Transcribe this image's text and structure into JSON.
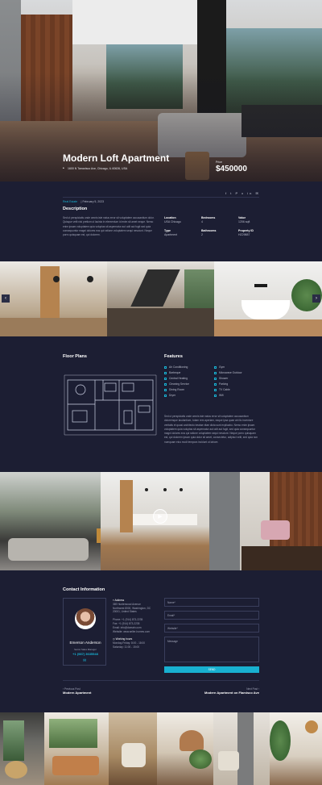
{
  "hero": {
    "title": "Modern Loft Apartment",
    "address": "1600 N Tamarisco Ave, Chicago, IL 60626, USA",
    "price_label": "Price",
    "price": "$450000"
  },
  "meta": {
    "category": "Real Estate",
    "date": "February 5, 2023",
    "share_icons": "f  t  P  x  in  ✉"
  },
  "description": {
    "heading": "Description",
    "paragraphs": [
      "Sed ut perspiciatis unde omnis iste natus error sit voluptatem accusantium dolor. Quisque velit nisi pretium ut lacinia in elementum id enim sit amet neque. Nemo enim ipsam voluptatem quia voluptas sit aspernatur aut odit aut fugit sed quia consequuntur magni dolores eos qui ratione voluptatem sequi nesciunt. Neque porro quisquam est, qui dolorem."
    ]
  },
  "details": [
    {
      "k": "Location",
      "v": "USA Chicago"
    },
    {
      "k": "Bedrooms",
      "v": "4"
    },
    {
      "k": "Value",
      "v": "1206 sqft"
    },
    {
      "k": "Type",
      "v": "Apartment"
    },
    {
      "k": "Bathrooms",
      "v": "2"
    },
    {
      "k": "Property ID",
      "v": "HZ29887"
    }
  ],
  "floor_plans": {
    "heading": "Floor Plans"
  },
  "features": {
    "heading": "Features",
    "items": [
      "Air Conditioning",
      "Gym",
      "Barbeque",
      "Microwave Outdoor",
      "Central Heating",
      "Shower",
      "Cleaning Service",
      "Parking",
      "Dining Room",
      "TV Cable",
      "Dryer",
      "Wifi"
    ],
    "paragraph": "Sed ut perspiciatis unde omnis iste natus error sit voluptatem accusantium doloremque laudantium, totam rem aperiam, eaque ipsa quae ab illo inventore veritatis et quasi architecto beatae vitae dicta sunt explicabo. Nemo enim ipsam voluptatem quia voluptas sit aspernatur aut odit aut fugit, sed quia consequuntur magni dolores eos qui ratione voluptatem sequi nesciunt. Neque porro quisquam est, qui dolorem ipsum quia dolor sit amet, consectetur, adipisci velit, sed quia non numquam eius modi tempora incidunt ut labore."
  },
  "contact": {
    "heading": "Contact Information",
    "agent_name": "Emerson Anderson",
    "agent_role": "Senior Sales Manager",
    "agent_phone": "+1 (987) 3635548",
    "address_label": "Address",
    "address_lines": [
      "369 Hunterwood Avenue",
      "Northwest 8000, Washington, DC",
      "20001, United States"
    ],
    "contact_lines": [
      "Phone: +1 (914) 873-2235",
      "Fax: +1 (914) 873-2235",
      "Email: info@domain.com",
      "Website: www.seller-homes.com"
    ],
    "hours_label": "Working hours",
    "hours_lines": [
      "Monday-Friday: 8:00 - 18:00",
      "Saturday: 11:00 - 15:00"
    ],
    "form": {
      "name": "Name*",
      "email": "Email*",
      "website": "Website*",
      "message": "Message",
      "send": "SEND"
    }
  },
  "post_nav": {
    "prev_small": "Previous Post",
    "prev_title": "Modern Apartment",
    "next_small": "Next Post",
    "next_title": "Modern Apartment on Flamisco Ave"
  },
  "colors": {
    "background": "#1c1e33",
    "accent": "#18b0d0"
  }
}
